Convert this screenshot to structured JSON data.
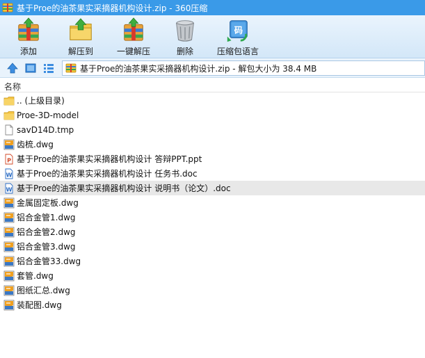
{
  "window": {
    "title": "基于Proe的油茶果实采摘器机构设计.zip - 360压缩",
    "icon": "archive-app-icon"
  },
  "toolbar": {
    "buttons": [
      {
        "label": "添加",
        "icon": "add-archive-icon"
      },
      {
        "label": "解压到",
        "icon": "extract-to-icon"
      },
      {
        "label": "一键解压",
        "icon": "one-click-extract-icon"
      },
      {
        "label": "删除",
        "icon": "trash-icon"
      },
      {
        "label": "压缩包语言",
        "icon": "archive-language-icon"
      }
    ]
  },
  "address": {
    "text": "基于Proe的油茶果实采摘器机构设计.zip - 解包大小为 38.4 MB",
    "icons": [
      "up-arrow-icon",
      "view-large-icon",
      "view-list-icon"
    ]
  },
  "columns": {
    "name": "名称"
  },
  "files": [
    {
      "name": ".. (上级目录)",
      "type": "folder"
    },
    {
      "name": "Proe-3D-model",
      "type": "folder"
    },
    {
      "name": "savD14D.tmp",
      "type": "blank"
    },
    {
      "name": "齿梳.dwg",
      "type": "dwg"
    },
    {
      "name": "基于Proe的油茶果实采摘器机构设计 答辩PPT.ppt",
      "type": "ppt"
    },
    {
      "name": "基于Proe的油茶果实采摘器机构设计 任务书.doc",
      "type": "doc"
    },
    {
      "name": "基于Proe的油茶果实采摘器机构设计 说明书（论文）.doc",
      "type": "doc",
      "selected": true
    },
    {
      "name": "金属固定板.dwg",
      "type": "dwg"
    },
    {
      "name": "铝合金管1.dwg",
      "type": "dwg"
    },
    {
      "name": "铝合金管2.dwg",
      "type": "dwg"
    },
    {
      "name": "铝合金管3.dwg",
      "type": "dwg"
    },
    {
      "name": "铝合金管33.dwg",
      "type": "dwg"
    },
    {
      "name": "套管.dwg",
      "type": "dwg"
    },
    {
      "name": "图纸汇总.dwg",
      "type": "dwg"
    },
    {
      "name": "装配图.dwg",
      "type": "dwg"
    }
  ],
  "colors": {
    "titlebar": "#3a9ae8",
    "toolbar": "#d3e7f8",
    "selected_row": "#e8e8e8",
    "folder": "#f5c342",
    "dwg": "#f0a020",
    "doc": "#2b6cc4",
    "ppt": "#d24726"
  }
}
